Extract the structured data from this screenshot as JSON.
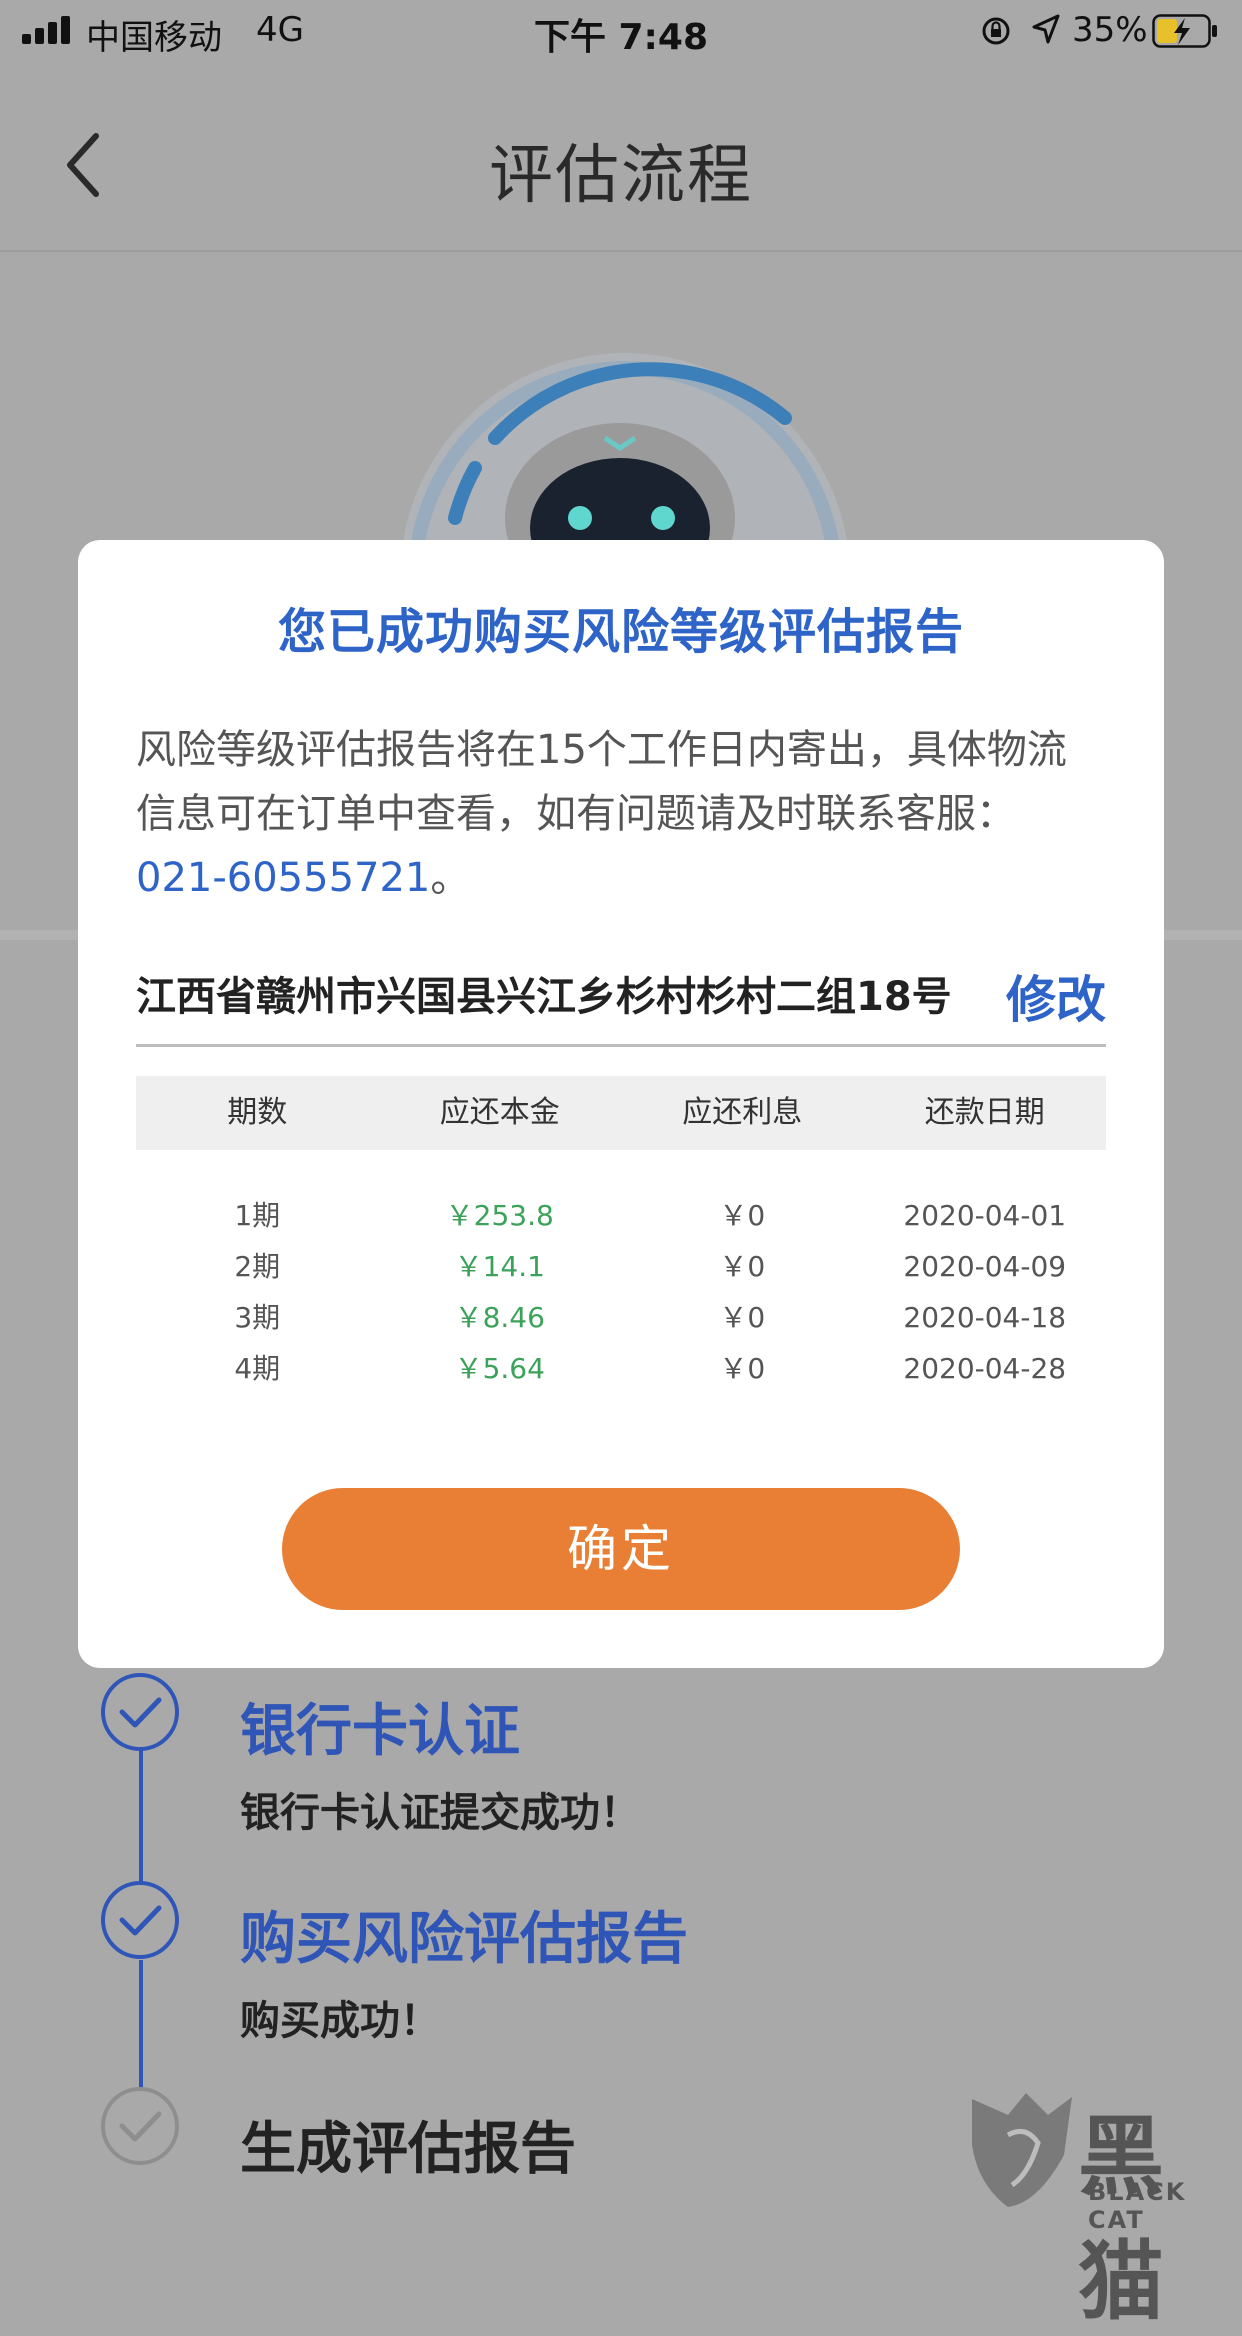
{
  "status_bar": {
    "carrier": "中国移动",
    "network": "4G",
    "time": "下午 7:48",
    "battery_percent": "35%"
  },
  "nav": {
    "title": "评估流程"
  },
  "modal": {
    "title": "您已成功购买风险等级评估报告",
    "body_text": "风险等级评估报告将在15个工作日内寄出，具体物流信息可在订单中查看，如有问题请及时联系客服：",
    "phone": "021-60555721",
    "body_end": "。",
    "address": "江西省赣州市兴国县兴江乡杉村杉村二组18号",
    "edit_label": "修改",
    "table": {
      "headers": [
        "期数",
        "应还本金",
        "应还利息",
        "还款日期"
      ],
      "rows": [
        {
          "period": "1期",
          "principal": "￥253.8",
          "interest": "￥0",
          "date": "2020-04-01"
        },
        {
          "period": "2期",
          "principal": "￥14.1",
          "interest": "￥0",
          "date": "2020-04-09"
        },
        {
          "period": "3期",
          "principal": "￥8.46",
          "interest": "￥0",
          "date": "2020-04-18"
        },
        {
          "period": "4期",
          "principal": "￥5.64",
          "interest": "￥0",
          "date": "2020-04-28"
        }
      ]
    },
    "confirm_label": "确定"
  },
  "steps": [
    {
      "title": "银行卡认证",
      "desc": "银行卡认证提交成功！",
      "status": "done",
      "color": "#2f55b7"
    },
    {
      "title": "购买风险评估报告",
      "desc": "购买成功！",
      "status": "done",
      "color": "#2f55b7"
    },
    {
      "title": "生成评估报告",
      "desc": "",
      "status": "pending",
      "color": "#222222"
    }
  ],
  "watermark": {
    "text_cn": "黑猫",
    "text_en": "BLACK CAT"
  },
  "colors": {
    "accent_blue": "#2e64c8",
    "confirm_orange": "#e87f34",
    "amount_green": "#3ca25a",
    "overlay_gray": "#a9a9a9"
  }
}
